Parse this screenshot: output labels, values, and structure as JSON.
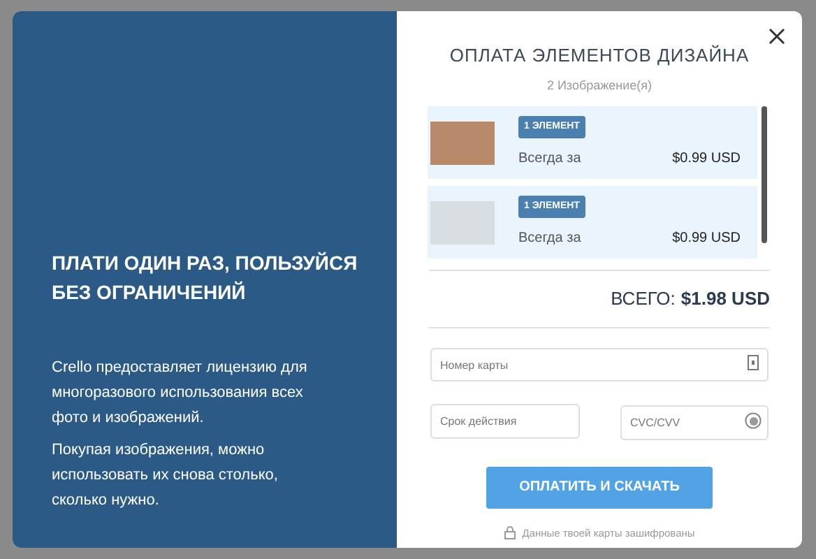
{
  "promo": {
    "heading": "ПЛАТИ ОДИН РАЗ, ПОЛЬЗУЙСЯ БЕЗ ОГРАНИЧЕНИЙ",
    "paragraphs": [
      "Crello предоставляет лицензию для многоразового использования всех фото и изображений.",
      "Покупая изображения, можно использовать их снова столько, сколько нужно."
    ]
  },
  "checkout": {
    "title": "ОПЛАТА ЭЛЕМЕНТОВ ДИЗАЙНА",
    "subtitle": "2 Изображение(я)",
    "items": [
      {
        "badge": "1 ЭЛЕМЕНТ",
        "label": "Всегда за",
        "price": "$0.99 USD"
      },
      {
        "badge": "1 ЭЛЕМЕНТ",
        "label": "Всегда за",
        "price": "$0.99 USD"
      }
    ],
    "total_label": "ВСЕГО:",
    "total_value": "$1.98 USD",
    "card_number": {
      "placeholder": "Номер карты"
    },
    "expiry": {
      "placeholder": "Срок действия"
    },
    "cvc": {
      "placeholder": "CVC/CVV"
    },
    "pay_button": "ОПЛАТИТЬ И СКАЧАТЬ",
    "secure_note": "Данные твоей карты зашифрованы"
  }
}
